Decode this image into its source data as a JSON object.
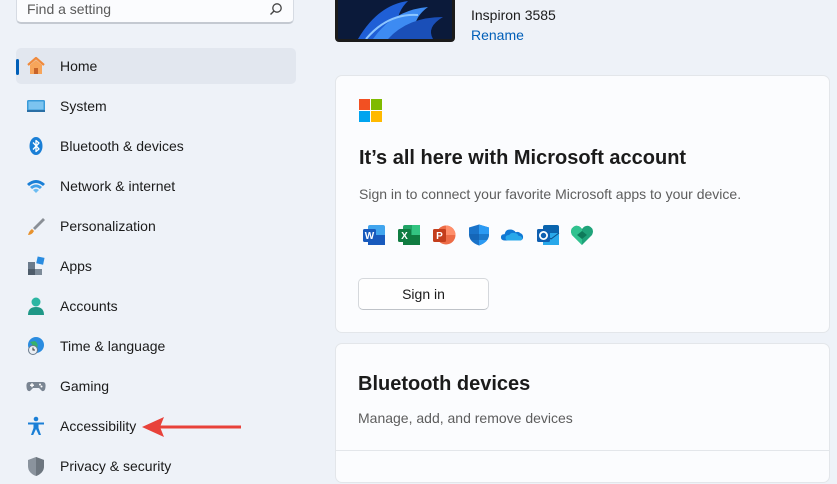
{
  "search": {
    "placeholder": "Find a setting"
  },
  "sidebar": {
    "items": [
      {
        "label": "Home",
        "icon": "home-icon",
        "active": true
      },
      {
        "label": "System",
        "icon": "system-icon"
      },
      {
        "label": "Bluetooth & devices",
        "icon": "bluetooth-icon"
      },
      {
        "label": "Network & internet",
        "icon": "wifi-icon"
      },
      {
        "label": "Personalization",
        "icon": "brush-icon"
      },
      {
        "label": "Apps",
        "icon": "apps-icon"
      },
      {
        "label": "Accounts",
        "icon": "person-icon"
      },
      {
        "label": "Time & language",
        "icon": "globe-clock-icon"
      },
      {
        "label": "Gaming",
        "icon": "gamepad-icon"
      },
      {
        "label": "Accessibility",
        "icon": "accessibility-icon"
      },
      {
        "label": "Privacy & security",
        "icon": "shield-icon"
      }
    ]
  },
  "device": {
    "name": "Inspiron 3585",
    "rename_label": "Rename"
  },
  "ms_card": {
    "title": "It’s all here with Microsoft account",
    "subtitle": "Sign in to connect your favorite Microsoft apps to your device.",
    "apps": [
      "word-icon",
      "excel-icon",
      "powerpoint-icon",
      "defender-icon",
      "onedrive-icon",
      "outlook-icon",
      "family-safety-icon"
    ],
    "signin_label": "Sign in"
  },
  "bt_card": {
    "title": "Bluetooth devices",
    "subtitle": "Manage, add, and remove devices"
  },
  "colors": {
    "accent": "#005fb8",
    "annotation_arrow": "#e8423a",
    "background": "#eef2f8"
  }
}
